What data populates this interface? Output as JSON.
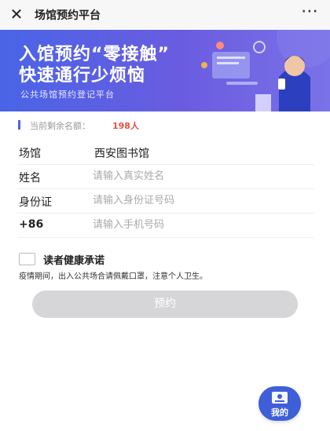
{
  "status_bar": {
    "clipped_text": "⋯ ⌂ ▬▬"
  },
  "nav": {
    "close_glyph": "✕",
    "title": "场馆预约平台",
    "more_glyph": "⋯"
  },
  "banner": {
    "line1": "入馆预约“零接触”",
    "line2": "快速通行少烦恼",
    "subtitle": "公共场馆预约登记平台"
  },
  "remaining": {
    "label": "当前剩余名额：",
    "count": "198人"
  },
  "form": {
    "venue": {
      "label": "场馆",
      "value": "西安图书馆"
    },
    "name": {
      "label": "姓名",
      "placeholder": "请输入真实姓名"
    },
    "id_card": {
      "label": "身份证",
      "placeholder": "请输入身份证号码"
    },
    "phone": {
      "label": "+86",
      "placeholder": "请输入手机号码"
    }
  },
  "consent": {
    "title": "读者健康承诺",
    "note": "疫情期间，出入公共场合请佩戴口罩，注意个人卫生。",
    "checked": false
  },
  "submit": {
    "label": "预约",
    "enabled": false
  },
  "fab": {
    "label": "我的",
    "icon": "user-card-icon"
  },
  "colors": {
    "accent": "#4a64e6",
    "count_red": "#e0533d",
    "button_disabled": "#d6d6d9",
    "fab_blue": "#3e5fd8"
  }
}
